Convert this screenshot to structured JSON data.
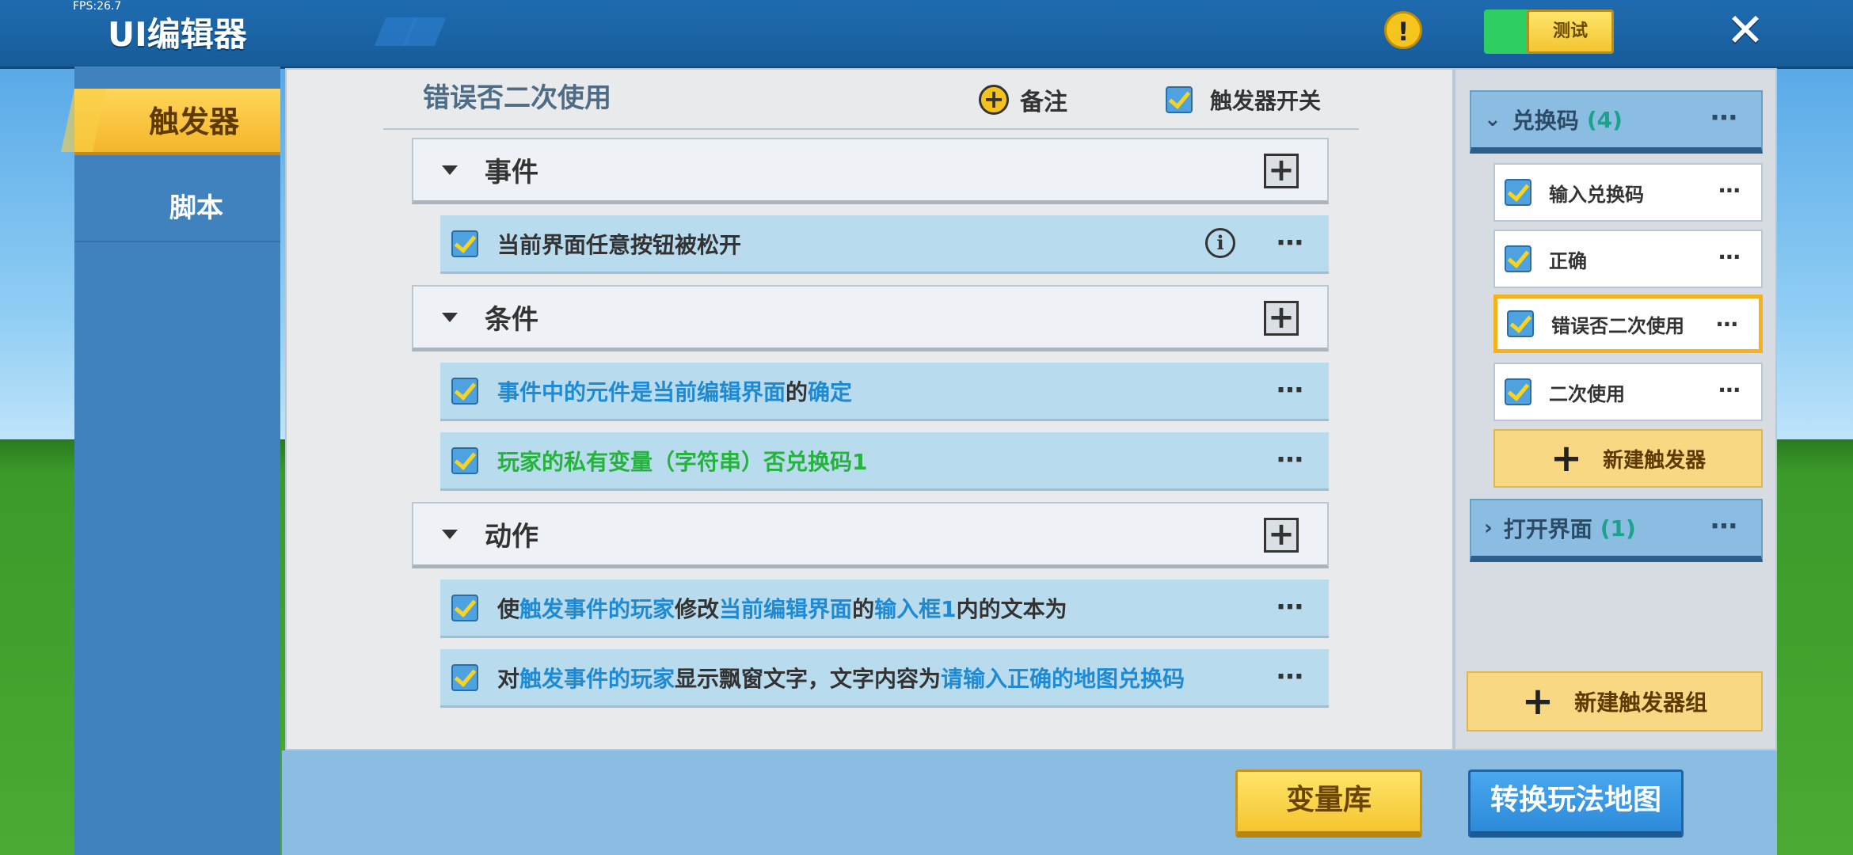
{
  "status": {
    "fps": "FPS:26.7"
  },
  "header": {
    "title": "UI编辑器",
    "test_label": "测试",
    "warning_glyph": "!",
    "close_glyph": "✕"
  },
  "sidebar": {
    "items": [
      {
        "label": "触发器",
        "active": true
      },
      {
        "label": "脚本",
        "active": false
      }
    ]
  },
  "editor": {
    "trigger_name": "错误否二次使用",
    "note_label": "备注",
    "switch_label": "触发器开关",
    "sections": {
      "event": {
        "label": "事件"
      },
      "condition": {
        "label": "条件"
      },
      "action": {
        "label": "动作"
      }
    },
    "event_rows": [
      {
        "text": "当前界面任意按钮被松开"
      }
    ],
    "condition_rows": [
      {
        "p1": "事件中的元件是当前编辑界面",
        "p2": "的",
        "p3": "确定"
      },
      {
        "text": "玩家的私有变量（字符串）否兑换码1"
      }
    ],
    "action_rows": [
      {
        "p1": "使",
        "p2": "触发事件的玩家",
        "p3": "修改",
        "p4": "当前编辑界面",
        "p5": "的",
        "p6": "输入框1",
        "p7": "内的文本为"
      },
      {
        "p1": "对",
        "p2": "触发事件的玩家",
        "p3": "显示飘窗文字，文字内容为",
        "p4": "请输入正确的地图兑换码"
      }
    ]
  },
  "tree": {
    "groups": [
      {
        "name": "兑换码",
        "count": "(4)"
      },
      {
        "name": "打开界面",
        "count": "(1)"
      }
    ],
    "triggers": [
      {
        "label": "输入兑换码",
        "selected": false
      },
      {
        "label": "正确",
        "selected": false
      },
      {
        "label": "错误否二次使用",
        "selected": true
      },
      {
        "label": "二次使用",
        "selected": false
      }
    ],
    "new_trigger_label": "新建触发器",
    "new_group_label": "新建触发器组"
  },
  "footer": {
    "variables_label": "变量库",
    "convert_label": "转换玩法地图"
  },
  "colors": {
    "accent_yellow": "#f4c52f",
    "accent_blue": "#2c8ad9",
    "link_blue": "#1e8ad3",
    "link_green": "#24b33b"
  },
  "icons": {
    "more": "⋯",
    "plus": "+",
    "info": "i"
  }
}
